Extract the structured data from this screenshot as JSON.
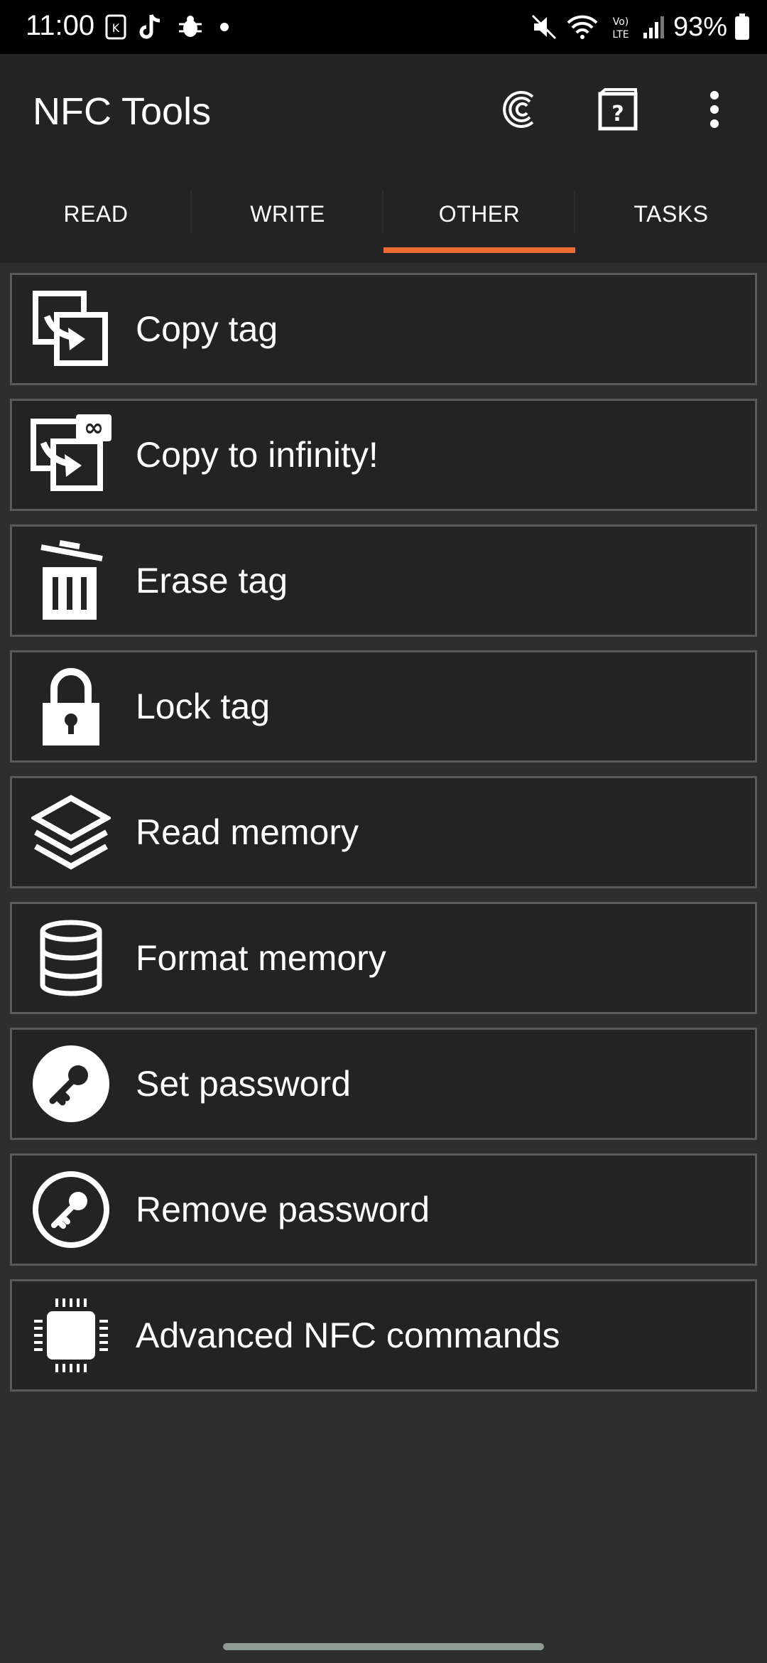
{
  "status_bar": {
    "time": "11:00",
    "battery_percent": "93%",
    "icons": [
      "kakao-icon",
      "tiktok-icon",
      "bug-icon",
      "dot-icon",
      "mute-icon",
      "wifi-icon",
      "volte-icon",
      "signal-icon",
      "battery-icon"
    ]
  },
  "app_bar": {
    "title": "NFC Tools",
    "actions": [
      "nfc-scan-icon",
      "help-icon",
      "more-vert-icon"
    ]
  },
  "tabs": [
    {
      "label": "READ",
      "active": false
    },
    {
      "label": "WRITE",
      "active": false
    },
    {
      "label": "OTHER",
      "active": true
    },
    {
      "label": "TASKS",
      "active": false
    }
  ],
  "items": [
    {
      "label": "Copy tag",
      "icon": "copy-tag-icon"
    },
    {
      "label": "Copy to infinity!",
      "icon": "copy-infinity-icon"
    },
    {
      "label": "Erase tag",
      "icon": "trash-icon"
    },
    {
      "label": "Lock tag",
      "icon": "lock-icon"
    },
    {
      "label": "Read memory",
      "icon": "layers-icon"
    },
    {
      "label": "Format memory",
      "icon": "database-icon"
    },
    {
      "label": "Set password",
      "icon": "key-filled-icon"
    },
    {
      "label": "Remove password",
      "icon": "key-outline-icon"
    },
    {
      "label": "Advanced NFC commands",
      "icon": "chip-icon"
    }
  ],
  "colors": {
    "background": "#2e2e2e",
    "surface": "#232323",
    "accent": "#ef6a33",
    "item_border": "#5a5a5a"
  }
}
